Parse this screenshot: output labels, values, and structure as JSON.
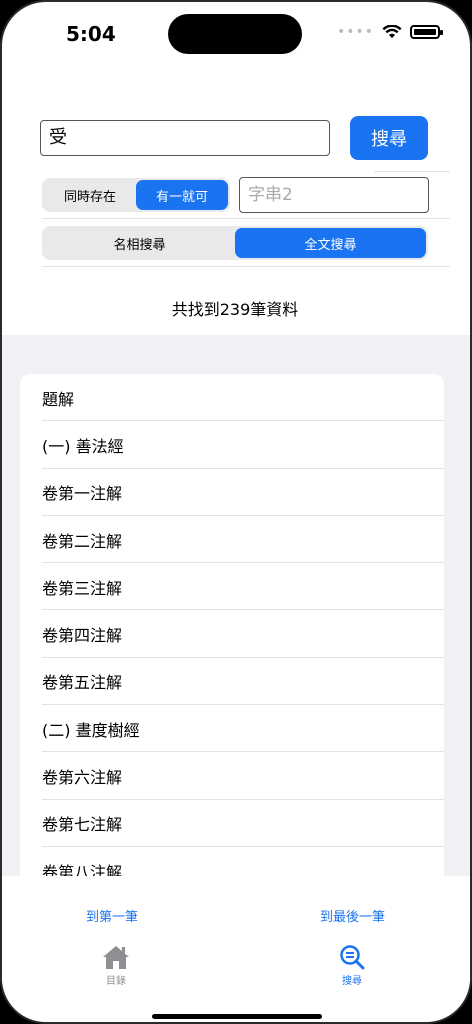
{
  "status": {
    "time": "5:04"
  },
  "search": {
    "query": "受",
    "button_label": "搜尋",
    "term2_placeholder": "字串2"
  },
  "mode_toggle": {
    "options": [
      "同時存在",
      "有一就可"
    ],
    "selected": "有一就可"
  },
  "scope_toggle": {
    "options": [
      "名相搜尋",
      "全文搜尋"
    ],
    "selected": "全文搜尋"
  },
  "result_count": "共找到239筆資料",
  "results": [
    "題解",
    "(一) 善法經",
    "卷第一注解",
    "卷第二注解",
    "卷第三注解",
    "卷第四注解",
    "卷第五注解",
    "(二) 晝度樹經",
    "卷第六注解",
    "卷第七注解",
    "卷第八注解"
  ],
  "nav": {
    "first_label": "到第一筆",
    "last_label": "到最後一筆"
  },
  "tabs": [
    {
      "label": "目錄",
      "icon": "home-icon",
      "active": false
    },
    {
      "label": "搜尋",
      "icon": "search-icon",
      "active": true
    }
  ],
  "colors": {
    "accent": "#1a73f0",
    "inactive": "#8e8e93"
  }
}
